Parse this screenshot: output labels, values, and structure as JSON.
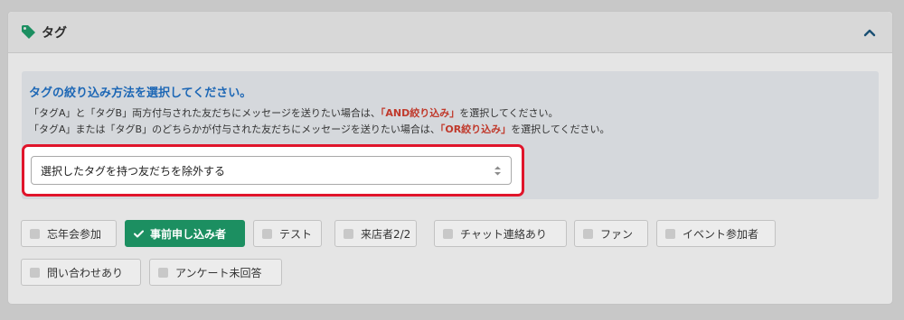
{
  "panel": {
    "title": "タグ",
    "icon": "tag-icon",
    "collapse_icon": "chevron-up-icon",
    "accent_color": "#1c8f61"
  },
  "info": {
    "heading": "タグの絞り込み方法を選択してください。",
    "line1_before": "「タグA」と「タグB」両方付与された友だちにメッセージを送りたい場合は、",
    "line1_highlight": "「AND絞り込み」",
    "line1_after": "を選択してください。",
    "line2_before": "「タグA」または「タグB」のどちらかが付与された友だちにメッセージを送りたい場合は、",
    "line2_highlight": "「OR絞り込み」",
    "line2_after": "を選択してください。"
  },
  "filter_select": {
    "selected": "選択したタグを持つ友だちを除外する",
    "icon": "select-arrows-icon"
  },
  "tags": [
    {
      "label": "忘年会参加",
      "selected": false
    },
    {
      "label": "事前申し込み者",
      "selected": true
    },
    {
      "label": "テスト",
      "selected": false
    },
    {
      "label": "来店者2/2",
      "selected": false
    },
    {
      "label": "チャット連絡あり",
      "selected": false
    },
    {
      "label": "ファン",
      "selected": false
    },
    {
      "label": "イベント参加者",
      "selected": false
    },
    {
      "label": "問い合わせあり",
      "selected": false
    },
    {
      "label": "アンケート未回答",
      "selected": false
    }
  ]
}
